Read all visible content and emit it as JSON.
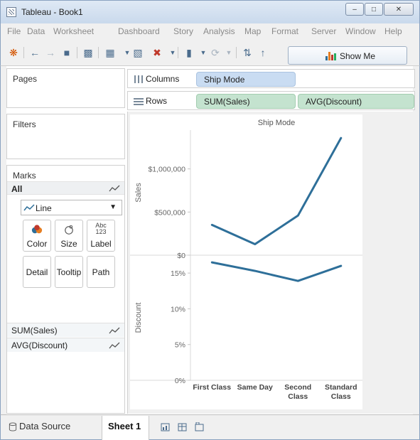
{
  "window": {
    "title": "Tableau - Book1"
  },
  "menu": [
    "File",
    "Data",
    "Worksheet",
    "Dashboard",
    "Story",
    "Analysis",
    "Map",
    "Format",
    "Server",
    "Window",
    "Help"
  ],
  "toolbar": {
    "show_me_label": "Show Me"
  },
  "panels": {
    "pages_title": "Pages",
    "filters_title": "Filters",
    "marks_title": "Marks",
    "marks_all": "All",
    "mark_type": "Line",
    "mark_buttons": {
      "color": "Color",
      "size": "Size",
      "label": "Label",
      "detail": "Detail",
      "tooltip": "Tooltip",
      "path": "Path",
      "label_icon": "Abc\n123"
    },
    "mark_fields": [
      "SUM(Sales)",
      "AVG(Discount)"
    ]
  },
  "shelves": {
    "columns_label": "Columns",
    "rows_label": "Rows",
    "columns_pills": [
      "Ship Mode"
    ],
    "rows_pills": [
      "SUM(Sales)",
      "AVG(Discount)"
    ]
  },
  "tabs": {
    "data_source": "Data Source",
    "sheet": "Sheet 1"
  },
  "colors": {
    "line": "#2e6f99",
    "dimension_pill": "#c9dcf2",
    "measure_pill": "#c4e3cf"
  },
  "chart_data": {
    "type": "line",
    "title": "Ship Mode",
    "categories": [
      "First Class",
      "Same Day",
      "Second Class",
      "Standard Class"
    ],
    "category_labels": [
      [
        "First Class"
      ],
      [
        "Same Day"
      ],
      [
        "Second",
        "Class"
      ],
      [
        "Standard",
        "Class"
      ]
    ],
    "panes": [
      {
        "ylabel": "Sales",
        "ylim": [
          0,
          1450000
        ],
        "ticks": [
          0,
          500000,
          1000000
        ],
        "tick_labels": [
          "$0",
          "$500,000",
          "$1,000,000"
        ],
        "series": [
          {
            "name": "SUM(Sales)",
            "values": [
              351000,
              128000,
              459000,
              1358000
            ]
          }
        ]
      },
      {
        "ylabel": "Discount",
        "ylim": [
          0,
          0.175
        ],
        "ticks": [
          0,
          0.05,
          0.1,
          0.15
        ],
        "tick_labels": [
          "0%",
          "5%",
          "10%",
          "15%"
        ],
        "series": [
          {
            "name": "AVG(Discount)",
            "values": [
              0.165,
              0.153,
              0.139,
              0.16
            ]
          }
        ]
      }
    ],
    "grid": false,
    "legend": "none"
  }
}
